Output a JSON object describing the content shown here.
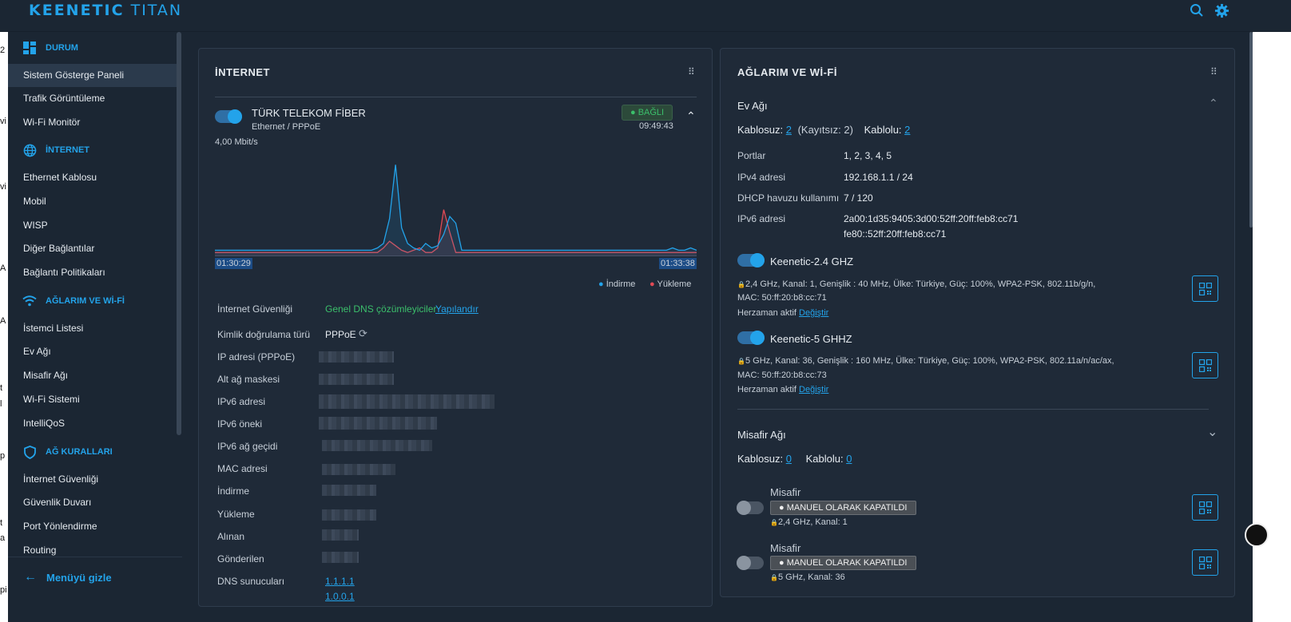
{
  "header": {
    "brand_bold": "KEENETIC",
    "brand_light": "TITAN",
    "search_icon": "search-icon",
    "settings_icon": "gear-icon"
  },
  "left_strip": [
    "2",
    "vi",
    "vi",
    "A",
    "A",
    "t",
    "l",
    "p",
    "t",
    "a",
    "pi"
  ],
  "sidebar": {
    "sections": [
      {
        "label": "DURUM",
        "icon": "dashboard-icon",
        "items": [
          "Sistem Gösterge Paneli",
          "Trafik Görüntüleme",
          "Wi-Fi Monitör"
        ]
      },
      {
        "label": "İNTERNET",
        "icon": "globe-icon",
        "items": [
          "Ethernet Kablosu",
          "Mobil",
          "WISP",
          "Diğer Bağlantılar",
          "Bağlantı Politikaları"
        ]
      },
      {
        "label": "AĞLARIM VE Wİ-Fİ",
        "icon": "wifi-icon",
        "items": [
          "İstemci Listesi",
          "Ev Ağı",
          "Misafir Ağı",
          "Wi-Fi Sistemi",
          "IntelliQoS"
        ]
      },
      {
        "label": "AĞ KURALLARI",
        "icon": "shield-icon",
        "items": [
          "İnternet Güvenliği",
          "Güvenlik Duvarı",
          "Port Yönlendirme",
          "Routing"
        ]
      }
    ],
    "hide_menu": "Menüyü gizle"
  },
  "internet": {
    "title": "İNTERNET",
    "connection_name": "TÜRK TELEKOM FİBER",
    "connection_type": "Ethernet / PPPoE",
    "status": "BAĞLI",
    "uptime": "09:49:43",
    "speed": "4,00 Mbit/s",
    "time_start": "01:30:29",
    "time_end": "01:33:38",
    "legend_download": "İndirme",
    "legend_upload": "Yükleme",
    "rows": [
      {
        "label": "İnternet Güvenliği"
      },
      {
        "label": "Kimlik doğrulama türü"
      },
      {
        "label": "IP adresi (PPPoE)"
      },
      {
        "label": "Alt ağ maskesi"
      },
      {
        "label": "IPv6 adresi"
      },
      {
        "label": "IPv6 öneki"
      },
      {
        "label": "IPv6 ağ geçidi"
      },
      {
        "label": "MAC adresi"
      },
      {
        "label": "İndirme"
      },
      {
        "label": "Yükleme"
      },
      {
        "label": "Alınan"
      },
      {
        "label": "Gönderilen"
      },
      {
        "label": "DNS sunucuları"
      }
    ],
    "security_value": "Genel DNS çözümleyiciler",
    "security_link": "Yapılandır",
    "auth_value": "PPPoE",
    "dns1": "1.1.1.1",
    "dns2": "1.0.0.1",
    "chart_data": {
      "type": "line",
      "series": [
        {
          "name": "İndirme",
          "color": "#23a3ea",
          "values": [
            0.2,
            0.2,
            0.2,
            0.2,
            0.2,
            0.2,
            0.2,
            0.2,
            0.2,
            0.2,
            0.2,
            0.2,
            0.2,
            0.2,
            0.2,
            0.2,
            0.2,
            0.2,
            0.2,
            0.2,
            0.2,
            0.2,
            0.2,
            0.2,
            0.2,
            0.2,
            0.2,
            0.3,
            0.5,
            1.6,
            4.0,
            1.2,
            0.5,
            0.3,
            0.2,
            0.5,
            0.3,
            0.4,
            0.9,
            1.7,
            1.4,
            0.2,
            0.2,
            0.2,
            0.2,
            0.2,
            0.2,
            0.2,
            0.2,
            0.2,
            0.2,
            0.2,
            0.2,
            0.2,
            0.2,
            0.2,
            0.2,
            0.2,
            0.2,
            0.2,
            0.2,
            0.2,
            0.2,
            0.2,
            0.2,
            0.2,
            0.2,
            0.2,
            0.2,
            0.2,
            0.2,
            0.2,
            0.2,
            0.2,
            0.2,
            0.2,
            0.3,
            0.2,
            0.2,
            0.3,
            0.2
          ]
        },
        {
          "name": "Yükleme",
          "color": "#e04a55",
          "values": [
            0.1,
            0.1,
            0.1,
            0.1,
            0.1,
            0.1,
            0.1,
            0.1,
            0.1,
            0.1,
            0.1,
            0.1,
            0.1,
            0.1,
            0.1,
            0.1,
            0.1,
            0.1,
            0.1,
            0.1,
            0.1,
            0.1,
            0.1,
            0.1,
            0.1,
            0.1,
            0.1,
            0.1,
            0.3,
            0.6,
            0.4,
            0.2,
            0.1,
            0.2,
            0.3,
            0.1,
            0.1,
            0.3,
            2.0,
            1.0,
            0.1,
            0.1,
            0.1,
            0.1,
            0.1,
            0.1,
            0.1,
            0.1,
            0.1,
            0.1,
            0.1,
            0.1,
            0.1,
            0.1,
            0.1,
            0.1,
            0.1,
            0.1,
            0.1,
            0.1,
            0.1,
            0.1,
            0.1,
            0.1,
            0.1,
            0.1,
            0.1,
            0.1,
            0.1,
            0.1,
            0.1,
            0.1,
            0.1,
            0.1,
            0.1,
            0.1,
            0.1,
            0.1,
            0.1,
            0.1,
            0.1
          ]
        }
      ],
      "ylim": [
        0,
        4.4
      ]
    }
  },
  "networks": {
    "title": "AĞLARIM VE Wİ-Fİ",
    "home": {
      "title": "Ev Ağı",
      "wireless_label": "Kablosuz:",
      "wireless_count": "2",
      "unregistered": "(Kayıtsız: 2)",
      "wired_label": "Kablolu:",
      "wired_count": "2",
      "rows": [
        {
          "label": "Portlar",
          "value": "1, 2, 3, 4, 5"
        },
        {
          "label": "IPv4 adresi",
          "value": "192.168.1.1 / 24"
        },
        {
          "label": "DHCP havuzu kullanımı",
          "value": "7 / 120"
        },
        {
          "label": "IPv6 adresi",
          "value": "2a00:1d35:9405:3d00:52ff:20ff:feb8:cc71"
        }
      ],
      "ipv6_second": "fe80::52ff:20ff:feb8:cc71",
      "wifi": [
        {
          "name": "Keenetic-2.4 GHZ",
          "details": "2,4 GHz,  Kanal: 1,  Genişlik : 40 MHz,  Ülke: Türkiye,  Güç: 100%,  WPA2-PSK,  802.11b/g/n,",
          "mac": "MAC: 50:ff:20:b8:cc:71",
          "always": "Herzaman aktif",
          "change": "Değiştir"
        },
        {
          "name": "Keenetic-5 GHHZ",
          "details": "5 GHz,  Kanal: 36,  Genişlik : 160 MHz,  Ülke: Türkiye,  Güç: 100%,  WPA2-PSK,  802.11a/n/ac/ax,",
          "mac": "MAC: 50:ff:20:b8:cc:73",
          "always": "Herzaman aktif",
          "change": "Değiştir"
        }
      ]
    },
    "guest": {
      "title": "Misafir Ağı",
      "wireless_label": "Kablosuz:",
      "wireless_count": "0",
      "wired_label": "Kablolu:",
      "wired_count": "0",
      "wifi": [
        {
          "name": "Misafir",
          "badge": "MANUEL OLARAK KAPATILDI",
          "details": "2,4 GHz,  Kanal: 1"
        },
        {
          "name": "Misafir",
          "badge": "MANUEL OLARAK KAPATILDI",
          "details": "5 GHz,  Kanal: 36"
        }
      ]
    }
  }
}
